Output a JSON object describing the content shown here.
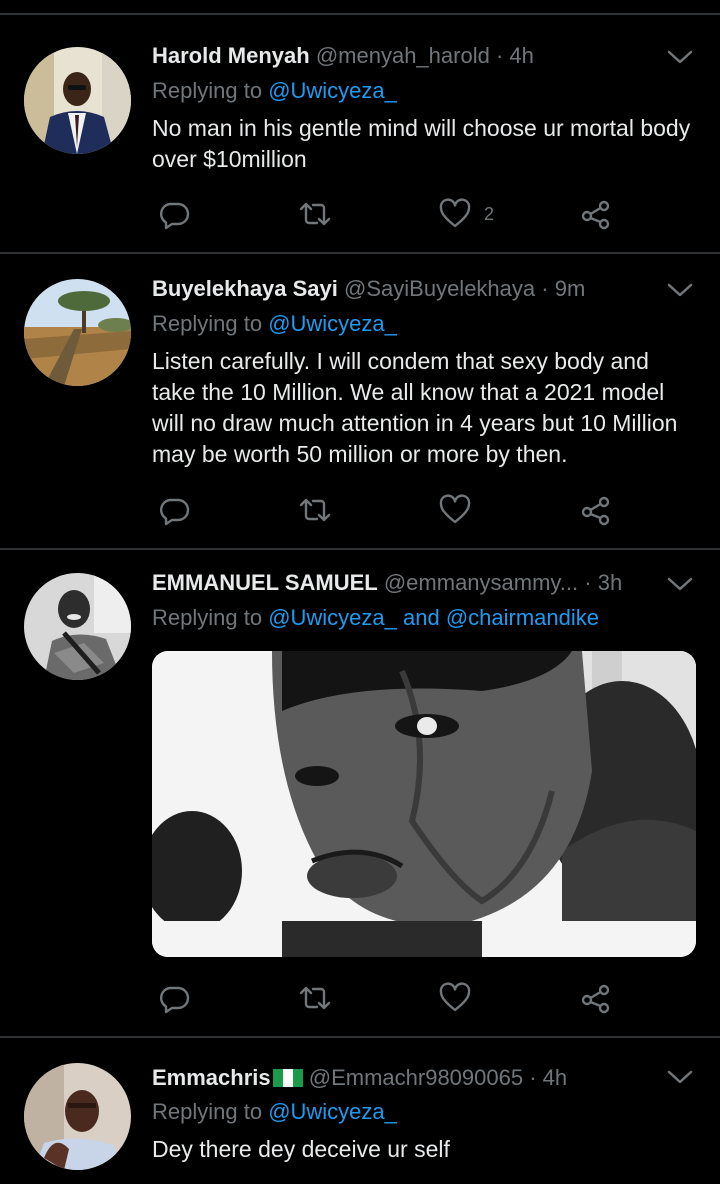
{
  "tweets": [
    {
      "name": "Harold Menyah",
      "handle": "@menyah_harold",
      "time": "· 4h",
      "replying_prefix": "Replying to ",
      "replying_to": "@Uwicyeza_",
      "text": "No man in his gentle mind will choose ur mortal body over $10million",
      "likes": "2"
    },
    {
      "name": "Buyelekhaya Sayi",
      "handle": "@SayiBuyelekhaya",
      "time": "· 9m",
      "replying_prefix": "Replying to ",
      "replying_to": "@Uwicyeza_",
      "text": "Listen carefully. I will condem that sexy body and take the 10 Million. We all know that a 2021 model will no draw much attention in 4 years but 10 Million may be worth 50 million or more by then."
    },
    {
      "name": "EMMANUEL SAMUEL",
      "handle": "@emmanysammy...",
      "time": "· 3h",
      "replying_prefix": "Replying to ",
      "replying_to": "@Uwicyeza_",
      "replying_and": " and ",
      "replying_to_2": "@chairmandike"
    },
    {
      "name": "Emmachris",
      "handle": "@Emmachr98090065",
      "time": "· 4h",
      "replying_prefix": "Replying to ",
      "replying_to": "@Uwicyeza_",
      "text": "Dey there dey deceive ur self"
    }
  ],
  "icons": {
    "reply": "reply-icon",
    "retweet": "retweet-icon",
    "like": "heart-icon",
    "share": "share-icon",
    "more": "chevron-down-icon"
  },
  "colors": {
    "background": "#000000",
    "text": "#e7e9ea",
    "secondary": "#71767b",
    "link": "#1d9bf0",
    "divider": "#2f3336"
  }
}
